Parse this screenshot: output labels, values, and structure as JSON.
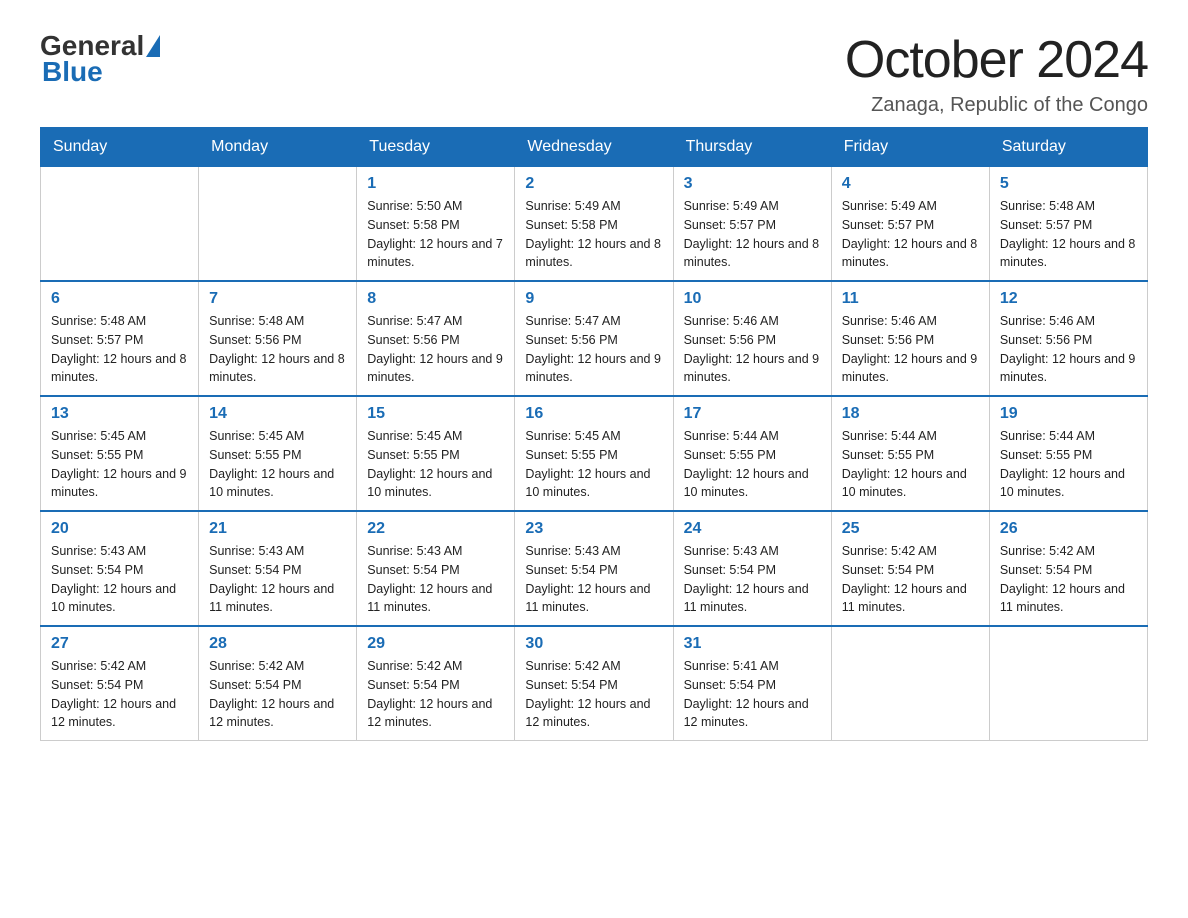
{
  "header": {
    "logo": {
      "general": "General",
      "blue": "Blue",
      "triangle_aria": "logo triangle"
    },
    "title": "October 2024",
    "location": "Zanaga, Republic of the Congo"
  },
  "calendar": {
    "days_of_week": [
      "Sunday",
      "Monday",
      "Tuesday",
      "Wednesday",
      "Thursday",
      "Friday",
      "Saturday"
    ],
    "weeks": [
      [
        {
          "day": "",
          "info": ""
        },
        {
          "day": "",
          "info": ""
        },
        {
          "day": "1",
          "info": "Sunrise: 5:50 AM\nSunset: 5:58 PM\nDaylight: 12 hours\nand 7 minutes."
        },
        {
          "day": "2",
          "info": "Sunrise: 5:49 AM\nSunset: 5:58 PM\nDaylight: 12 hours\nand 8 minutes."
        },
        {
          "day": "3",
          "info": "Sunrise: 5:49 AM\nSunset: 5:57 PM\nDaylight: 12 hours\nand 8 minutes."
        },
        {
          "day": "4",
          "info": "Sunrise: 5:49 AM\nSunset: 5:57 PM\nDaylight: 12 hours\nand 8 minutes."
        },
        {
          "day": "5",
          "info": "Sunrise: 5:48 AM\nSunset: 5:57 PM\nDaylight: 12 hours\nand 8 minutes."
        }
      ],
      [
        {
          "day": "6",
          "info": "Sunrise: 5:48 AM\nSunset: 5:57 PM\nDaylight: 12 hours\nand 8 minutes."
        },
        {
          "day": "7",
          "info": "Sunrise: 5:48 AM\nSunset: 5:56 PM\nDaylight: 12 hours\nand 8 minutes."
        },
        {
          "day": "8",
          "info": "Sunrise: 5:47 AM\nSunset: 5:56 PM\nDaylight: 12 hours\nand 9 minutes."
        },
        {
          "day": "9",
          "info": "Sunrise: 5:47 AM\nSunset: 5:56 PM\nDaylight: 12 hours\nand 9 minutes."
        },
        {
          "day": "10",
          "info": "Sunrise: 5:46 AM\nSunset: 5:56 PM\nDaylight: 12 hours\nand 9 minutes."
        },
        {
          "day": "11",
          "info": "Sunrise: 5:46 AM\nSunset: 5:56 PM\nDaylight: 12 hours\nand 9 minutes."
        },
        {
          "day": "12",
          "info": "Sunrise: 5:46 AM\nSunset: 5:56 PM\nDaylight: 12 hours\nand 9 minutes."
        }
      ],
      [
        {
          "day": "13",
          "info": "Sunrise: 5:45 AM\nSunset: 5:55 PM\nDaylight: 12 hours\nand 9 minutes."
        },
        {
          "day": "14",
          "info": "Sunrise: 5:45 AM\nSunset: 5:55 PM\nDaylight: 12 hours\nand 10 minutes."
        },
        {
          "day": "15",
          "info": "Sunrise: 5:45 AM\nSunset: 5:55 PM\nDaylight: 12 hours\nand 10 minutes."
        },
        {
          "day": "16",
          "info": "Sunrise: 5:45 AM\nSunset: 5:55 PM\nDaylight: 12 hours\nand 10 minutes."
        },
        {
          "day": "17",
          "info": "Sunrise: 5:44 AM\nSunset: 5:55 PM\nDaylight: 12 hours\nand 10 minutes."
        },
        {
          "day": "18",
          "info": "Sunrise: 5:44 AM\nSunset: 5:55 PM\nDaylight: 12 hours\nand 10 minutes."
        },
        {
          "day": "19",
          "info": "Sunrise: 5:44 AM\nSunset: 5:55 PM\nDaylight: 12 hours\nand 10 minutes."
        }
      ],
      [
        {
          "day": "20",
          "info": "Sunrise: 5:43 AM\nSunset: 5:54 PM\nDaylight: 12 hours\nand 10 minutes."
        },
        {
          "day": "21",
          "info": "Sunrise: 5:43 AM\nSunset: 5:54 PM\nDaylight: 12 hours\nand 11 minutes."
        },
        {
          "day": "22",
          "info": "Sunrise: 5:43 AM\nSunset: 5:54 PM\nDaylight: 12 hours\nand 11 minutes."
        },
        {
          "day": "23",
          "info": "Sunrise: 5:43 AM\nSunset: 5:54 PM\nDaylight: 12 hours\nand 11 minutes."
        },
        {
          "day": "24",
          "info": "Sunrise: 5:43 AM\nSunset: 5:54 PM\nDaylight: 12 hours\nand 11 minutes."
        },
        {
          "day": "25",
          "info": "Sunrise: 5:42 AM\nSunset: 5:54 PM\nDaylight: 12 hours\nand 11 minutes."
        },
        {
          "day": "26",
          "info": "Sunrise: 5:42 AM\nSunset: 5:54 PM\nDaylight: 12 hours\nand 11 minutes."
        }
      ],
      [
        {
          "day": "27",
          "info": "Sunrise: 5:42 AM\nSunset: 5:54 PM\nDaylight: 12 hours\nand 12 minutes."
        },
        {
          "day": "28",
          "info": "Sunrise: 5:42 AM\nSunset: 5:54 PM\nDaylight: 12 hours\nand 12 minutes."
        },
        {
          "day": "29",
          "info": "Sunrise: 5:42 AM\nSunset: 5:54 PM\nDaylight: 12 hours\nand 12 minutes."
        },
        {
          "day": "30",
          "info": "Sunrise: 5:42 AM\nSunset: 5:54 PM\nDaylight: 12 hours\nand 12 minutes."
        },
        {
          "day": "31",
          "info": "Sunrise: 5:41 AM\nSunset: 5:54 PM\nDaylight: 12 hours\nand 12 minutes."
        },
        {
          "day": "",
          "info": ""
        },
        {
          "day": "",
          "info": ""
        }
      ]
    ]
  }
}
